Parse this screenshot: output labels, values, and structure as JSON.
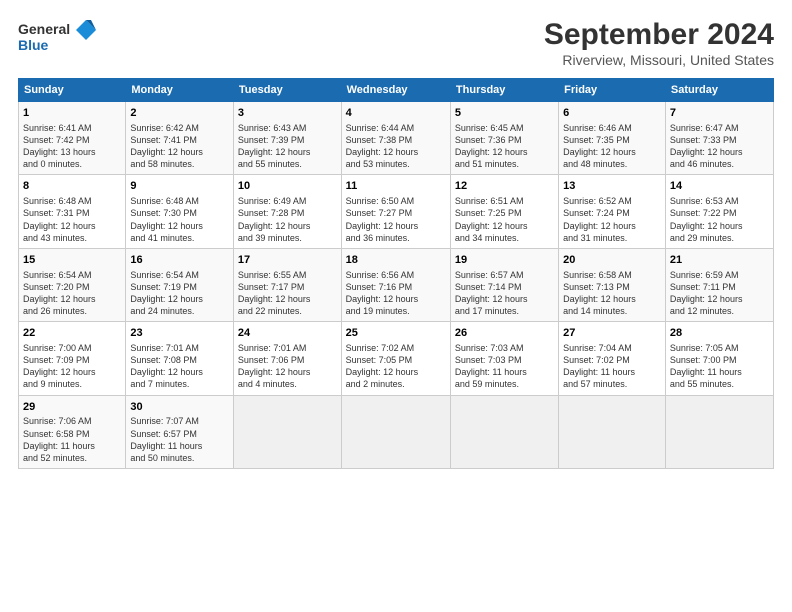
{
  "header": {
    "logo_line1": "General",
    "logo_line2": "Blue",
    "title": "September 2024",
    "subtitle": "Riverview, Missouri, United States"
  },
  "days_of_week": [
    "Sunday",
    "Monday",
    "Tuesday",
    "Wednesday",
    "Thursday",
    "Friday",
    "Saturday"
  ],
  "weeks": [
    [
      {
        "day": "1",
        "info": "Sunrise: 6:41 AM\nSunset: 7:42 PM\nDaylight: 13 hours\nand 0 minutes."
      },
      {
        "day": "2",
        "info": "Sunrise: 6:42 AM\nSunset: 7:41 PM\nDaylight: 12 hours\nand 58 minutes."
      },
      {
        "day": "3",
        "info": "Sunrise: 6:43 AM\nSunset: 7:39 PM\nDaylight: 12 hours\nand 55 minutes."
      },
      {
        "day": "4",
        "info": "Sunrise: 6:44 AM\nSunset: 7:38 PM\nDaylight: 12 hours\nand 53 minutes."
      },
      {
        "day": "5",
        "info": "Sunrise: 6:45 AM\nSunset: 7:36 PM\nDaylight: 12 hours\nand 51 minutes."
      },
      {
        "day": "6",
        "info": "Sunrise: 6:46 AM\nSunset: 7:35 PM\nDaylight: 12 hours\nand 48 minutes."
      },
      {
        "day": "7",
        "info": "Sunrise: 6:47 AM\nSunset: 7:33 PM\nDaylight: 12 hours\nand 46 minutes."
      }
    ],
    [
      {
        "day": "8",
        "info": "Sunrise: 6:48 AM\nSunset: 7:31 PM\nDaylight: 12 hours\nand 43 minutes."
      },
      {
        "day": "9",
        "info": "Sunrise: 6:48 AM\nSunset: 7:30 PM\nDaylight: 12 hours\nand 41 minutes."
      },
      {
        "day": "10",
        "info": "Sunrise: 6:49 AM\nSunset: 7:28 PM\nDaylight: 12 hours\nand 39 minutes."
      },
      {
        "day": "11",
        "info": "Sunrise: 6:50 AM\nSunset: 7:27 PM\nDaylight: 12 hours\nand 36 minutes."
      },
      {
        "day": "12",
        "info": "Sunrise: 6:51 AM\nSunset: 7:25 PM\nDaylight: 12 hours\nand 34 minutes."
      },
      {
        "day": "13",
        "info": "Sunrise: 6:52 AM\nSunset: 7:24 PM\nDaylight: 12 hours\nand 31 minutes."
      },
      {
        "day": "14",
        "info": "Sunrise: 6:53 AM\nSunset: 7:22 PM\nDaylight: 12 hours\nand 29 minutes."
      }
    ],
    [
      {
        "day": "15",
        "info": "Sunrise: 6:54 AM\nSunset: 7:20 PM\nDaylight: 12 hours\nand 26 minutes."
      },
      {
        "day": "16",
        "info": "Sunrise: 6:54 AM\nSunset: 7:19 PM\nDaylight: 12 hours\nand 24 minutes."
      },
      {
        "day": "17",
        "info": "Sunrise: 6:55 AM\nSunset: 7:17 PM\nDaylight: 12 hours\nand 22 minutes."
      },
      {
        "day": "18",
        "info": "Sunrise: 6:56 AM\nSunset: 7:16 PM\nDaylight: 12 hours\nand 19 minutes."
      },
      {
        "day": "19",
        "info": "Sunrise: 6:57 AM\nSunset: 7:14 PM\nDaylight: 12 hours\nand 17 minutes."
      },
      {
        "day": "20",
        "info": "Sunrise: 6:58 AM\nSunset: 7:13 PM\nDaylight: 12 hours\nand 14 minutes."
      },
      {
        "day": "21",
        "info": "Sunrise: 6:59 AM\nSunset: 7:11 PM\nDaylight: 12 hours\nand 12 minutes."
      }
    ],
    [
      {
        "day": "22",
        "info": "Sunrise: 7:00 AM\nSunset: 7:09 PM\nDaylight: 12 hours\nand 9 minutes."
      },
      {
        "day": "23",
        "info": "Sunrise: 7:01 AM\nSunset: 7:08 PM\nDaylight: 12 hours\nand 7 minutes."
      },
      {
        "day": "24",
        "info": "Sunrise: 7:01 AM\nSunset: 7:06 PM\nDaylight: 12 hours\nand 4 minutes."
      },
      {
        "day": "25",
        "info": "Sunrise: 7:02 AM\nSunset: 7:05 PM\nDaylight: 12 hours\nand 2 minutes."
      },
      {
        "day": "26",
        "info": "Sunrise: 7:03 AM\nSunset: 7:03 PM\nDaylight: 11 hours\nand 59 minutes."
      },
      {
        "day": "27",
        "info": "Sunrise: 7:04 AM\nSunset: 7:02 PM\nDaylight: 11 hours\nand 57 minutes."
      },
      {
        "day": "28",
        "info": "Sunrise: 7:05 AM\nSunset: 7:00 PM\nDaylight: 11 hours\nand 55 minutes."
      }
    ],
    [
      {
        "day": "29",
        "info": "Sunrise: 7:06 AM\nSunset: 6:58 PM\nDaylight: 11 hours\nand 52 minutes."
      },
      {
        "day": "30",
        "info": "Sunrise: 7:07 AM\nSunset: 6:57 PM\nDaylight: 11 hours\nand 50 minutes."
      },
      {
        "day": "",
        "info": ""
      },
      {
        "day": "",
        "info": ""
      },
      {
        "day": "",
        "info": ""
      },
      {
        "day": "",
        "info": ""
      },
      {
        "day": "",
        "info": ""
      }
    ]
  ]
}
